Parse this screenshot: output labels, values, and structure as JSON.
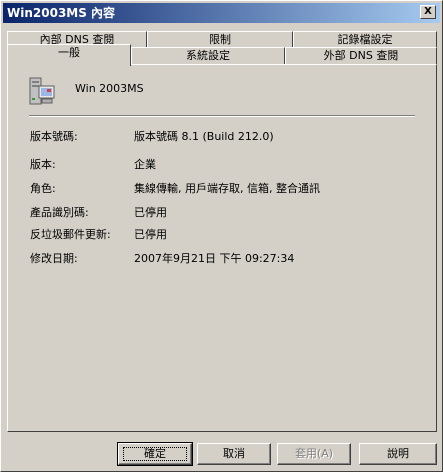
{
  "window": {
    "title": "Win2003MS 內容",
    "close_label": "X"
  },
  "tabs": {
    "back_row": [
      "內部 DNS 查閱",
      "限制",
      "記錄檔設定"
    ],
    "front_row": [
      "一般",
      "系統設定",
      "外部 DNS 查閱"
    ],
    "active": "一般"
  },
  "general": {
    "icon": "server-computer-icon",
    "server_name": "Win 2003MS",
    "fields": [
      {
        "label": "版本號碼:",
        "value": "版本號碼 8.1 (Build 212.0)"
      },
      {
        "label": "版本:",
        "value": "企業"
      },
      {
        "label": "角色:",
        "value": "集線傳輸, 用戶端存取, 信箱, 整合通訊"
      },
      {
        "label": "產品識別碼:",
        "value": "已停用"
      },
      {
        "label": "反垃圾郵件更新:",
        "value": "已停用"
      },
      {
        "label": "修改日期:",
        "value": "2007年9月21日 下午 09:27:34"
      }
    ]
  },
  "buttons": {
    "ok": "確定",
    "cancel": "取消",
    "apply": "套用(A)",
    "help": "說明"
  }
}
